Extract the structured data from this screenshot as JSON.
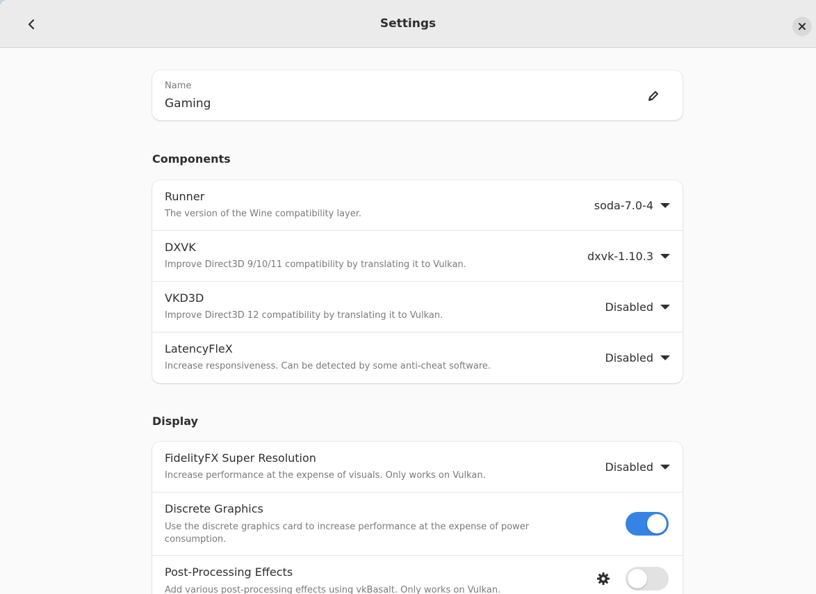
{
  "window": {
    "title": "Settings"
  },
  "name_card": {
    "label": "Name",
    "value": "Gaming"
  },
  "components": {
    "heading": "Components",
    "rows": [
      {
        "title": "Runner",
        "subtitle": "The version of the Wine compatibility layer.",
        "value": "soda-7.0-4"
      },
      {
        "title": "DXVK",
        "subtitle": "Improve Direct3D 9/10/11 compatibility by translating it to Vulkan.",
        "value": "dxvk-1.10.3"
      },
      {
        "title": "VKD3D",
        "subtitle": "Improve Direct3D 12 compatibility by translating it to Vulkan.",
        "value": "Disabled"
      },
      {
        "title": "LatencyFleX",
        "subtitle": "Increase responsiveness. Can be detected by some anti-cheat software.",
        "value": "Disabled"
      }
    ]
  },
  "display": {
    "heading": "Display",
    "fsr": {
      "title": "FidelityFX Super Resolution",
      "subtitle": "Increase performance at the expense of visuals. Only works on Vulkan.",
      "value": "Disabled"
    },
    "discrete": {
      "title": "Discrete Graphics",
      "subtitle": "Use the discrete graphics card to increase performance at the expense of power consumption.",
      "enabled": true
    },
    "post": {
      "title": "Post-Processing Effects",
      "subtitle": "Add various post-processing effects using vkBasalt. Only works on Vulkan.",
      "enabled": false
    }
  },
  "colors": {
    "accent": "#3584e4",
    "header_bg": "#ebebeb",
    "card_bg": "#ffffff"
  },
  "icons": {
    "back": "chevron-left-icon",
    "close": "close-icon",
    "edit": "pencil-icon",
    "settings": "gear-icon"
  }
}
